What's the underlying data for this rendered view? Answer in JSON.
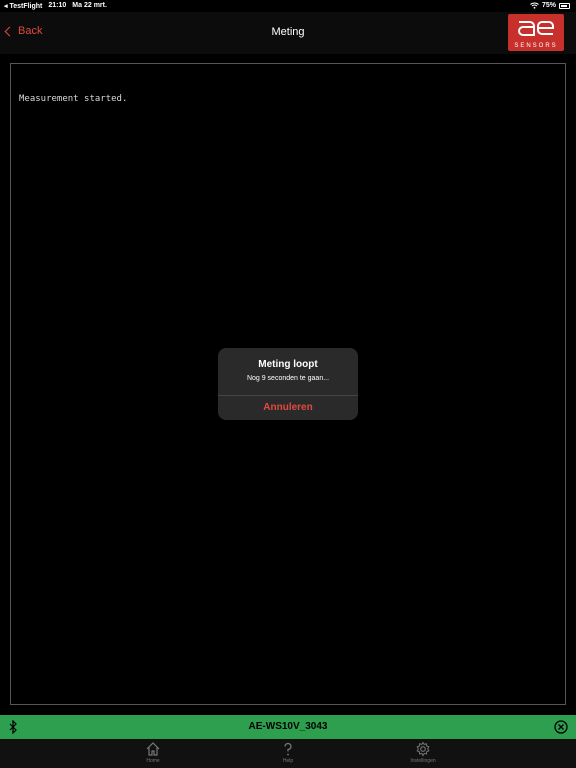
{
  "status_bar": {
    "app": "◂ TestFlight",
    "time": "21:10",
    "date": "Ma 22 mrt.",
    "battery": "75%"
  },
  "nav": {
    "back_label": "Back",
    "title": "Meting",
    "logo_text": "SENSORS"
  },
  "console": {
    "text": "Measurement started."
  },
  "alert": {
    "title": "Meting loopt",
    "message": "Nog 9 seconden te gaan...",
    "cancel_label": "Annuleren"
  },
  "device_bar": {
    "name": "AE-WS10V_3043",
    "color": "#2e9f4e"
  },
  "tabs": [
    {
      "label": "Home",
      "icon": "home-icon"
    },
    {
      "label": "Help",
      "icon": "help-icon"
    },
    {
      "label": "Instellingen",
      "icon": "gear-icon"
    }
  ],
  "colors": {
    "accent": "#e04a3f",
    "brand": "#c8302c"
  }
}
